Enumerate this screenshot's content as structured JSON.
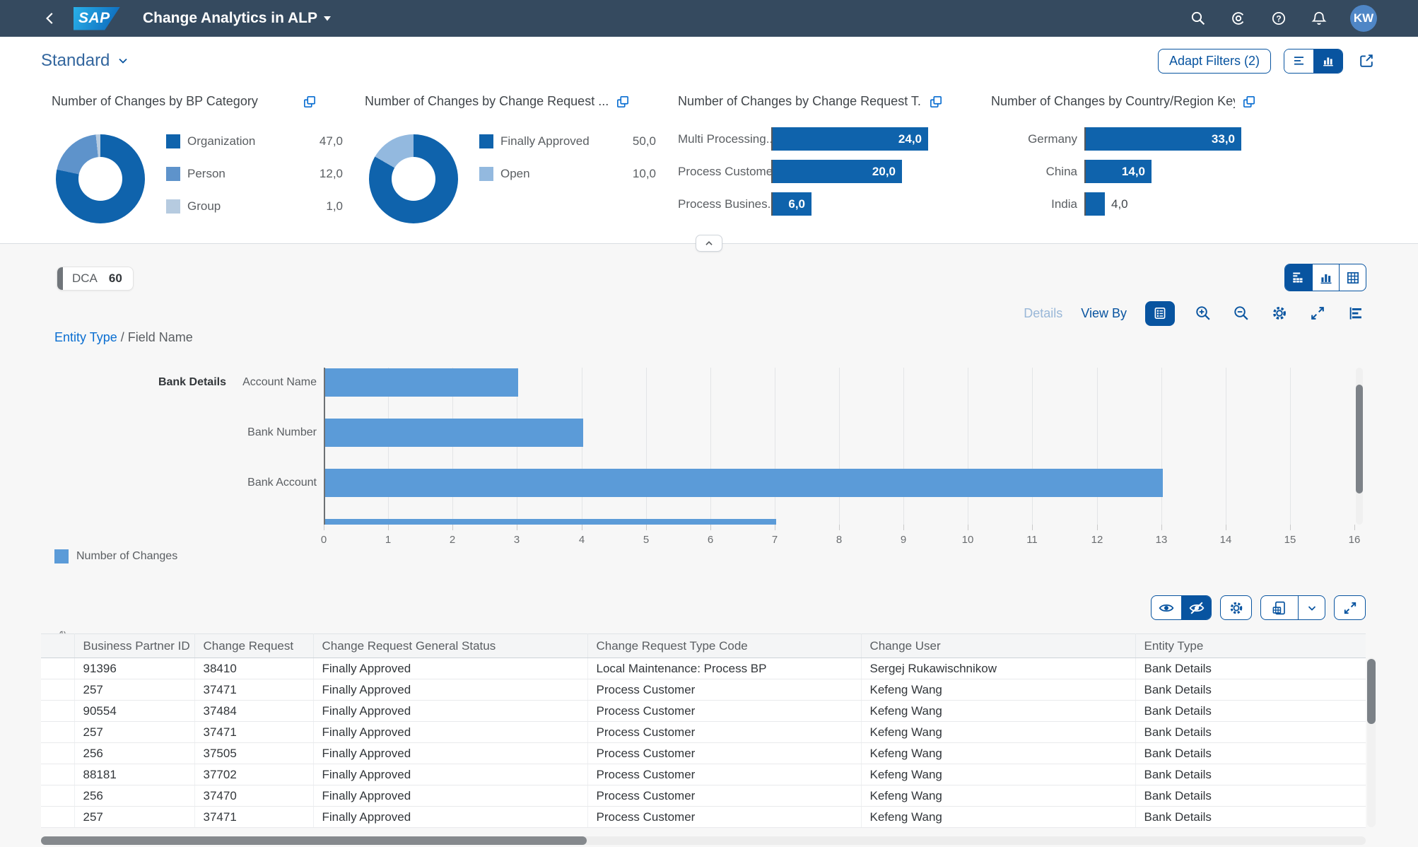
{
  "colors": {
    "shell_bg": "#354a5f",
    "accent": "#0854a0",
    "link": "#0a6ed1",
    "page_bg": "#f7f7f7",
    "chart_dark_blue": "#0f63ac",
    "chart_light_blue": "#5b9bd8"
  },
  "shell": {
    "logo_text": "SAP",
    "title": "Change Analytics in ALP",
    "avatar_initials": "KW"
  },
  "variant": {
    "name": "Standard"
  },
  "filter_bar": {
    "adapt_filters": "Adapt Filters (2)"
  },
  "content_header": {
    "dca_label": "DCA",
    "dca_count": "60"
  },
  "chart_toolbar": {
    "details": "Details",
    "view_by": "View By"
  },
  "breadcrumb": {
    "link": "Entity Type",
    "separator": "/",
    "current": "Field Name"
  },
  "icons": {
    "shell": [
      "back-icon",
      "search-icon",
      "copilot-icon",
      "help-icon",
      "bell-icon"
    ],
    "filter_bar": [
      "chevron-down-icon",
      "filterbar-view-icon",
      "chart-view-icon",
      "share-icon",
      "copy-icon",
      "collapse-icon"
    ],
    "content": [
      "hybrid-view-icon",
      "bar-chart-view-icon",
      "table-view-icon",
      "legend-toggle-icon",
      "zoom-in-icon",
      "zoom-out-icon",
      "settings-icon",
      "fullscreen-icon",
      "horizontal-bar-chart-icon",
      "show-details-icon",
      "hide-details-icon",
      "export-spreadsheet-icon",
      "dropdown-chevron-icon"
    ]
  },
  "chart_data": [
    {
      "id": "bp-category",
      "type": "donut",
      "title": "Number of Changes by BP Category",
      "series": [
        {
          "label": "Organization",
          "value": 47,
          "display": "47,0",
          "color": "#0f63ac"
        },
        {
          "label": "Person",
          "value": 12,
          "display": "12,0",
          "color": "#5e93cb"
        },
        {
          "label": "Group",
          "value": 1,
          "display": "1,0",
          "color": "#b6cbe0"
        }
      ]
    },
    {
      "id": "change-request-status",
      "type": "donut",
      "title": "Number of Changes by Change Request ...",
      "series": [
        {
          "label": "Finally Approved",
          "value": 50,
          "display": "50,0",
          "color": "#0f63ac"
        },
        {
          "label": "Open",
          "value": 10,
          "display": "10,0",
          "color": "#93b9df"
        }
      ]
    },
    {
      "id": "change-request-type",
      "type": "bar",
      "title": "Number of Changes by Change Request T...",
      "bar_color": "#0f63ac",
      "xmax": 24,
      "series": [
        {
          "label": "Multi Processing...",
          "value": 24,
          "display": "24,0"
        },
        {
          "label": "Process Customer",
          "value": 20,
          "display": "20,0"
        },
        {
          "label": "Process Busines...",
          "value": 6,
          "display": "6,0"
        }
      ]
    },
    {
      "id": "country-region",
      "type": "bar",
      "title": "Number of Changes by Country/Region Key",
      "bar_color": "#0f63ac",
      "xmax": 33,
      "series": [
        {
          "label": "Germany",
          "value": 33,
          "display": "33,0"
        },
        {
          "label": "China",
          "value": 14,
          "display": "14,0"
        },
        {
          "label": "India",
          "value": 4,
          "display": "4,0"
        }
      ]
    },
    {
      "id": "main-chart",
      "type": "bar-horizontal",
      "ylabel": "Entity Type / Field Name",
      "group_label": "Bank Details",
      "categories": [
        "Account Name",
        "Bank Number",
        "Bank Account"
      ],
      "values": [
        3,
        4,
        13
      ],
      "clipped_next_bar_value": 7,
      "xlim": [
        0,
        16
      ],
      "x_ticks": [
        0,
        1,
        2,
        3,
        4,
        5,
        6,
        7,
        8,
        9,
        10,
        11,
        12,
        13,
        14,
        15,
        16
      ],
      "bar_color": "#5b9bd8",
      "legend_label": "Number of Changes",
      "legend_position": "bottom-left",
      "grid": true
    }
  ],
  "table": {
    "columns": [
      "Business Partner ID",
      "Change Request",
      "Change Request General Status",
      "Change Request Type Code",
      "Change User",
      "Entity Type"
    ],
    "rows": [
      [
        "91396",
        "38410",
        "Finally Approved",
        "Local Maintenance: Process BP",
        "Sergej Rukawischnikow",
        "Bank Details"
      ],
      [
        "257",
        "37471",
        "Finally Approved",
        "Process Customer",
        "Kefeng Wang",
        "Bank Details"
      ],
      [
        "90554",
        "37484",
        "Finally Approved",
        "Process Customer",
        "Kefeng Wang",
        "Bank Details"
      ],
      [
        "257",
        "37471",
        "Finally Approved",
        "Process Customer",
        "Kefeng Wang",
        "Bank Details"
      ],
      [
        "256",
        "37505",
        "Finally Approved",
        "Process Customer",
        "Kefeng Wang",
        "Bank Details"
      ],
      [
        "88181",
        "37702",
        "Finally Approved",
        "Process Customer",
        "Kefeng Wang",
        "Bank Details"
      ],
      [
        "256",
        "37470",
        "Finally Approved",
        "Process Customer",
        "Kefeng Wang",
        "Bank Details"
      ],
      [
        "257",
        "37471",
        "Finally Approved",
        "Process Customer",
        "Kefeng Wang",
        "Bank Details"
      ]
    ]
  }
}
